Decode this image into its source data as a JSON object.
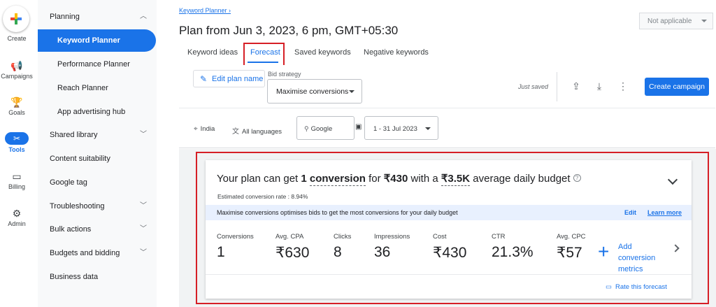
{
  "rail": {
    "create": "Create",
    "campaigns": "Campaigns",
    "goals": "Goals",
    "tools": "Tools",
    "billing": "Billing",
    "admin": "Admin"
  },
  "nav": {
    "planning": "Planning",
    "keyword_planner": "Keyword Planner",
    "performance_planner": "Performance Planner",
    "reach_planner": "Reach Planner",
    "app_advertising_hub": "App advertising hub",
    "shared_library": "Shared library",
    "content_suitability": "Content suitability",
    "google_tag": "Google tag",
    "troubleshooting": "Troubleshooting",
    "bulk_actions": "Bulk actions",
    "budgets_and_bidding": "Budgets and bidding",
    "business_data": "Business data"
  },
  "header": {
    "breadcrumb": "Keyword Planner",
    "title": "Plan from Jun 3, 2023, 6 pm, GMT+05:30",
    "not_applicable": "Not applicable"
  },
  "tabs": {
    "keyword_ideas": "Keyword ideas",
    "forecast": "Forecast",
    "saved_keywords": "Saved keywords",
    "negative_keywords": "Negative keywords"
  },
  "toolbar": {
    "edit_plan_name": "Edit plan name",
    "bid_strategy_label": "Bid strategy",
    "bid_strategy_value": "Maximise conversions",
    "just_saved": "Just saved",
    "create_campaign": "Create campaign"
  },
  "filters": {
    "location": "India",
    "language": "All languages",
    "network": "Google",
    "date_range": "1 - 31 Jul 2023"
  },
  "forecast": {
    "headline_1": "Your plan can get ",
    "conversions_count": "1",
    "conversions_word": "conversion",
    "headline_2": " for ",
    "cost": "₹430",
    "headline_3": " with a ",
    "budget": "₹3.5K",
    "headline_4": " average daily budget",
    "conversion_rate": "Estimated conversion rate : 8.94%",
    "info_text": "Maximise conversions optimises bids to get the most conversions for your daily budget",
    "info_edit": "Edit",
    "info_learn_more": "Learn more",
    "metrics": [
      {
        "label": "Conversions",
        "value": "1"
      },
      {
        "label": "Avg. CPA",
        "value": "₹630"
      },
      {
        "label": "Clicks",
        "value": "8"
      },
      {
        "label": "Impressions",
        "value": "36"
      },
      {
        "label": "Cost",
        "value": "₹430"
      },
      {
        "label": "CTR",
        "value": "21.3%"
      },
      {
        "label": "Avg. CPC",
        "value": "₹57"
      }
    ],
    "add_metrics": "Add conversion metrics",
    "rate_forecast": "Rate this forecast"
  },
  "colors": {
    "accent": "#1a73e8",
    "highlight_border": "#d61f26",
    "info_bar": "#e8f0fe"
  }
}
